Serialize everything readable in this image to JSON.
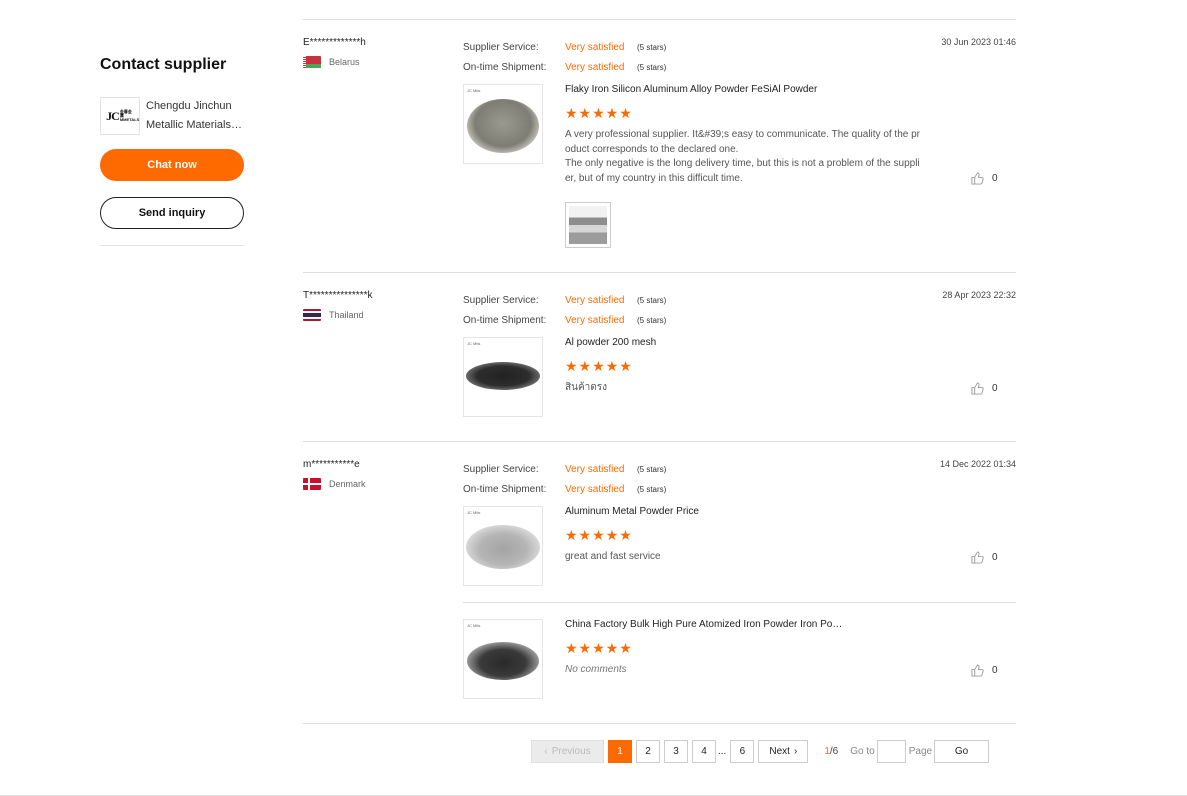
{
  "contact": {
    "title": "Contact supplier",
    "logo_text": "JC",
    "logo_small_text": "金春金属 MMETALS",
    "company_line1": "Chengdu Jinchun",
    "company_line2": "Metallic Materials Co., Ltd.",
    "chat_label": "Chat now",
    "inquiry_label": "Send inquiry"
  },
  "labels": {
    "supplier_service": "Supplier Service:",
    "ontime_shipment": "On-time Shipment:"
  },
  "reviews": [
    {
      "reviewer": "E*************h",
      "country": "Belarus",
      "service": "Very satisfied",
      "service_stars": "(5 stars)",
      "shipment": "Very satisfied",
      "shipment_stars": "(5 stars)",
      "date": "30 Jun 2023 01:46",
      "products": [
        {
          "title": "Flaky Iron Silicon Aluminum Alloy Powder FeSiAl Powder",
          "stars": "★★★★★",
          "rating": 5,
          "comment_line1": "A very professional supplier. It&#39;s easy to communicate. The quality of the product corresponds to the declared one.",
          "comment_line2": "The only negative is the long delivery time, but this is not a problem of the supplier, but of my country in this difficult time.",
          "likes": "0"
        }
      ]
    },
    {
      "reviewer": "T***************k",
      "country": "Thailand",
      "service": "Very satisfied",
      "service_stars": "(5 stars)",
      "shipment": "Very satisfied",
      "shipment_stars": "(5 stars)",
      "date": "28 Apr 2023 22:32",
      "products": [
        {
          "title": "Al powder 200 mesh",
          "stars": "★★★★★",
          "rating": 5,
          "comment": "สินค้าตรง",
          "likes": "0"
        }
      ]
    },
    {
      "reviewer": "m***********e",
      "country": "Denmark",
      "service": "Very satisfied",
      "service_stars": "(5 stars)",
      "shipment": "Very satisfied",
      "shipment_stars": "(5 stars)",
      "date": "14 Dec 2022 01:34",
      "products": [
        {
          "title": "Aluminum Metal Powder Price",
          "stars": "★★★★★",
          "rating": 5,
          "comment": "great and fast service",
          "likes": "0"
        },
        {
          "title": "China Factory Bulk High Pure Atomized Iron Powder Iron Powder",
          "stars": "★★★★★",
          "rating": 5,
          "comment": "No comments",
          "likes": "0"
        }
      ]
    }
  ],
  "thumb_label": "JC Mtls",
  "pagination": {
    "prev": "Previous",
    "pages": [
      "1",
      "2",
      "3",
      "4",
      "6"
    ],
    "ellipsis": "...",
    "next": "Next",
    "current": "1",
    "total": "/6",
    "goto": "Go to",
    "page": "Page",
    "go": "Go"
  },
  "colors": {
    "accent": "#ff6a00"
  }
}
